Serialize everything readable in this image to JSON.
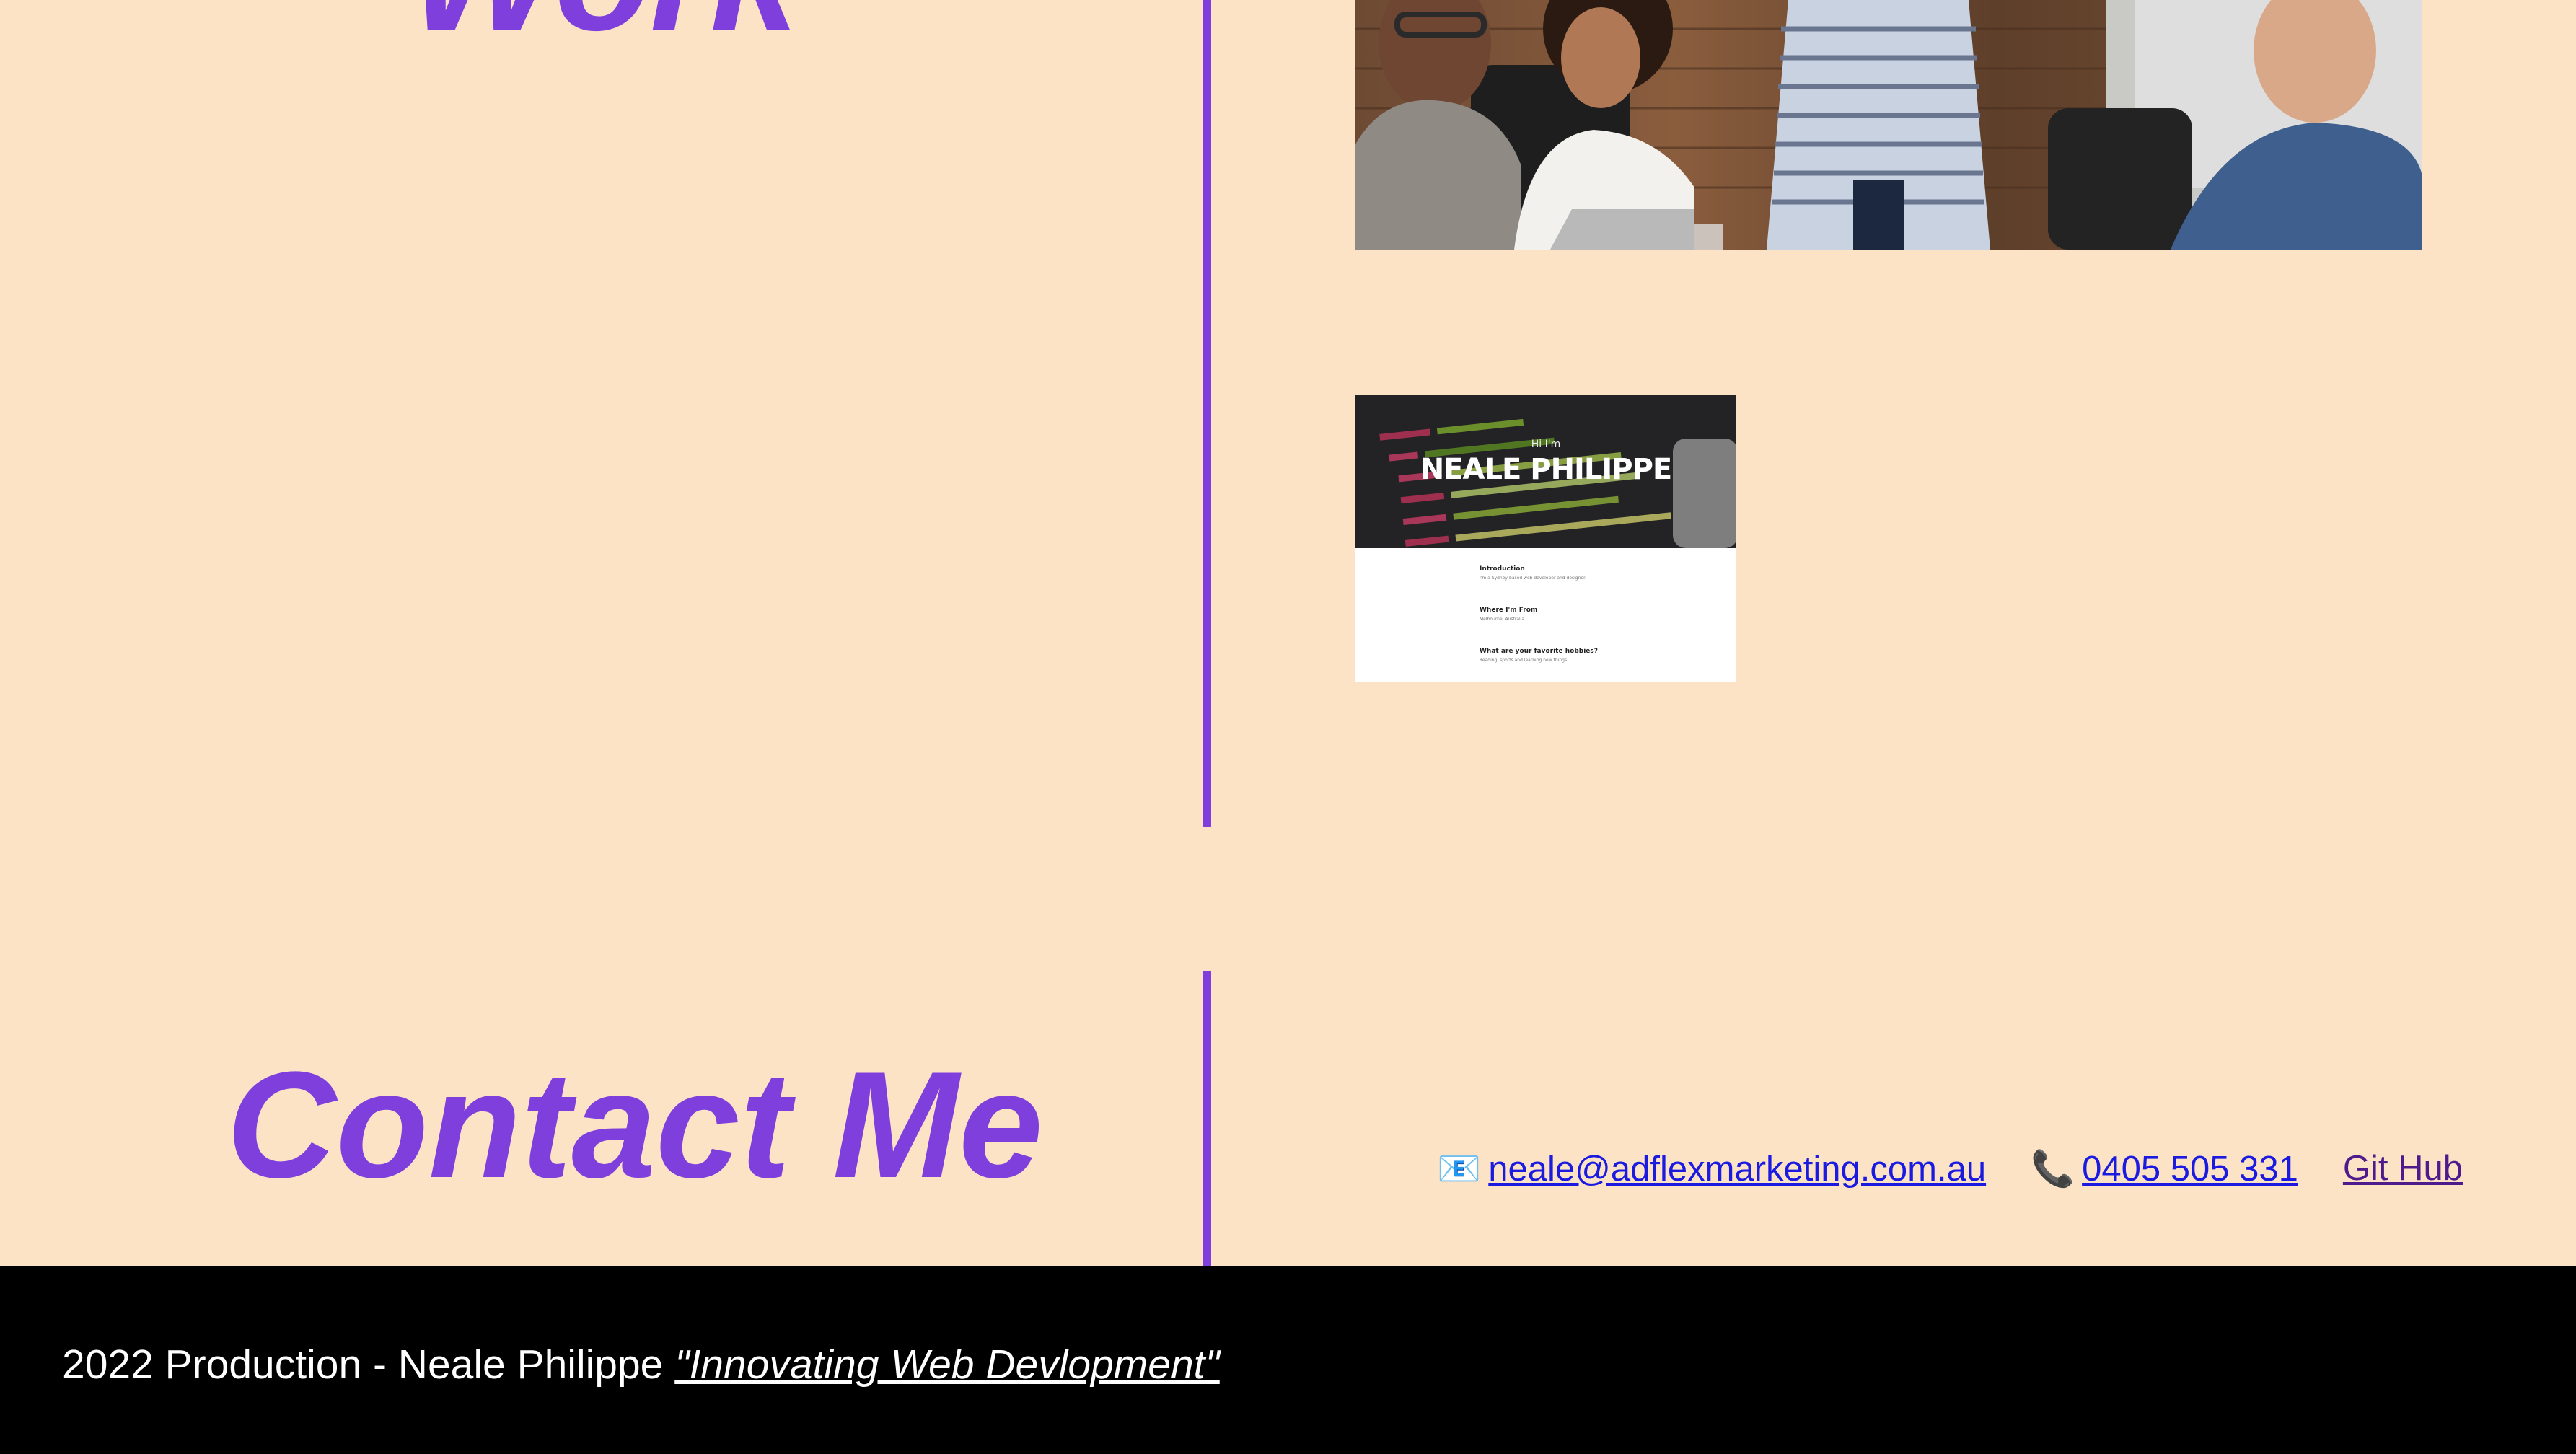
{
  "work": {
    "heading": "Work"
  },
  "projects": [
    {
      "name": "team-meeting-photo"
    },
    {
      "name": "neale-philippe-site-preview",
      "preview": {
        "small_intro": "Hi I'm",
        "title": "NEALE PHILIPPE",
        "sections": [
          {
            "heading": "Introduction",
            "text": "I'm a Sydney-based web developer and designer."
          },
          {
            "heading": "Where I'm From",
            "text": "Melbourne, Australia"
          },
          {
            "heading": "What are your favorite hobbies?",
            "text": "Reading, sports and learning new things"
          }
        ]
      }
    }
  ],
  "contact": {
    "heading": "Contact Me",
    "email_icon": "📧",
    "email": "neale@adflexmarketing.com.au",
    "phone_icon": "📞",
    "phone": "0405 505 331",
    "github": "Git Hub"
  },
  "footer": {
    "text": "2022 Production - Neale Philippe ",
    "tagline": "\"Innovating Web Devlopment\""
  },
  "colors": {
    "background": "#fce3c6",
    "accent": "#7e3fdc",
    "footer": "#000000",
    "link": "#1a1ae0",
    "visited_link": "#4f1a8c"
  }
}
